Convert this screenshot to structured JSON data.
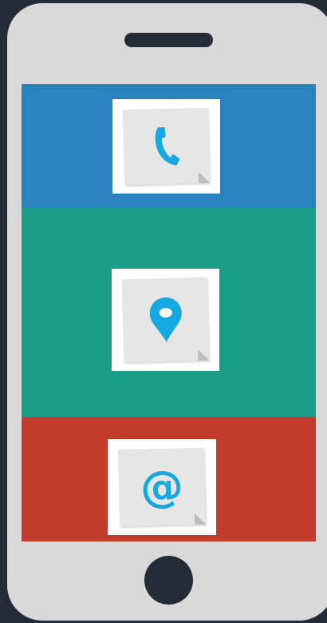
{
  "colors": {
    "background": "#222b36",
    "phone_body": "#d9d9d9",
    "phone_panel": "#2a82be",
    "location_panel": "#189d86",
    "email_panel": "#c33c2b",
    "icon_blue": "#16a9e1"
  },
  "panels": [
    {
      "name": "phone",
      "icon": "phone-icon"
    },
    {
      "name": "location",
      "icon": "location-pin-icon"
    },
    {
      "name": "email",
      "icon": "at-sign-icon"
    }
  ],
  "email_symbol": "@"
}
